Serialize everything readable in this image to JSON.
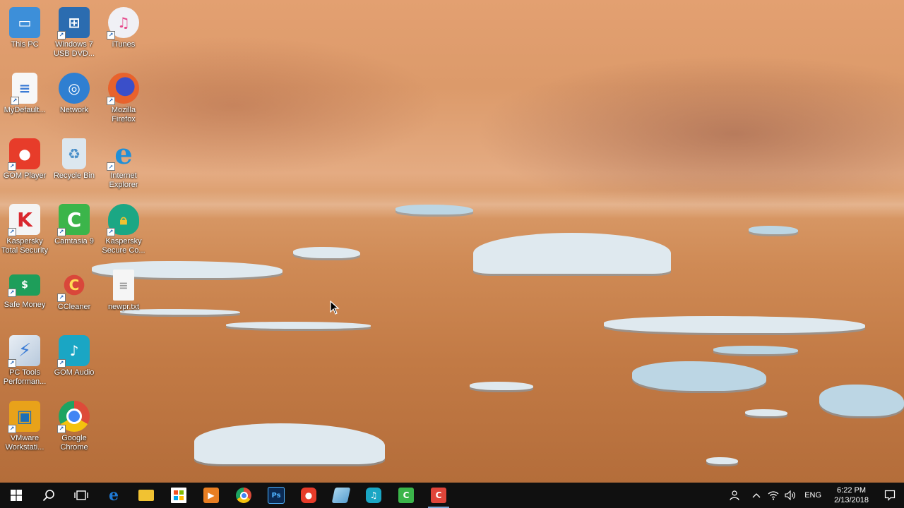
{
  "desktop": {
    "icons": [
      {
        "label": "This PC",
        "icon": "this-pc-icon",
        "color": "#3d8fd9"
      },
      {
        "label": "Windows 7 USB DVD...",
        "icon": "windows-usb-tool-icon",
        "color": "#2b6cb0"
      },
      {
        "label": "iTunes",
        "icon": "itunes-icon",
        "color": "#f0f0f5"
      },
      {
        "label": "MyDefault...",
        "icon": "document-icon",
        "color": "#f7f7f7"
      },
      {
        "label": "Network",
        "icon": "network-icon",
        "color": "#2f7fd1"
      },
      {
        "label": "Mozilla Firefox",
        "icon": "firefox-icon",
        "color": "#e8622c"
      },
      {
        "label": "GOM Player",
        "icon": "gom-player-icon",
        "color": "#e73c2a"
      },
      {
        "label": "Recycle Bin",
        "icon": "recycle-bin-icon",
        "color": "#dce7ef"
      },
      {
        "label": "Internet Explorer",
        "icon": "internet-explorer-icon",
        "color": "#1f8fd8"
      },
      {
        "label": "Kaspersky Total Security",
        "icon": "kaspersky-icon",
        "color": "#f4f4f4"
      },
      {
        "label": "Camtasia 9",
        "icon": "camtasia-icon",
        "color": "#3bb54a"
      },
      {
        "label": "Kaspersky Secure Co...",
        "icon": "kaspersky-vpn-icon",
        "color": "#1ba784"
      },
      {
        "label": "Safe Money",
        "icon": "safe-money-icon",
        "color": "#1e9e5a"
      },
      {
        "label": "CCleaner",
        "icon": "ccleaner-icon",
        "color": "#d9473a"
      },
      {
        "label": "newpr.txt",
        "icon": "text-file-icon",
        "color": "#f5f5f5"
      },
      {
        "label": "PC Tools Performan...",
        "icon": "pc-tools-icon",
        "color": "#3a7bd5"
      },
      {
        "label": "GOM Audio",
        "icon": "gom-audio-icon",
        "color": "#1aa6c4"
      },
      {
        "label": "VMware Workstati...",
        "icon": "vmware-icon",
        "color": "#e8a21a"
      },
      {
        "label": "Google Chrome",
        "icon": "chrome-icon",
        "color": "#dd4b39"
      }
    ]
  },
  "taskbar": {
    "start": {
      "icon": "windows-start-icon"
    },
    "search": {
      "icon": "search-icon"
    },
    "task_view": {
      "icon": "task-view-icon"
    },
    "pinned": [
      {
        "name": "Microsoft Edge",
        "icon": "edge-icon",
        "glyph": "e",
        "color": "#1f7ad6",
        "running": false
      },
      {
        "name": "File Explorer",
        "icon": "file-explorer-icon",
        "glyph": "",
        "color": "#f1c232",
        "running": false
      },
      {
        "name": "Microsoft Store",
        "icon": "store-icon",
        "glyph": "",
        "color": "#3a8fd9",
        "running": false
      },
      {
        "name": "Media Player",
        "icon": "media-player-icon",
        "glyph": "▶",
        "color": "#e87e22",
        "running": false
      },
      {
        "name": "Google Chrome",
        "icon": "chrome-icon",
        "glyph": "",
        "color": "#dd4b39",
        "running": false
      },
      {
        "name": "Photoshop",
        "icon": "photoshop-icon",
        "glyph": "Ps",
        "color": "#0b2a53",
        "running": false
      },
      {
        "name": "GOM Player",
        "icon": "gom-player-icon",
        "glyph": "",
        "color": "#e73c2a",
        "running": false
      },
      {
        "name": "Notepad",
        "icon": "notepad-icon",
        "glyph": "",
        "color": "#6fb3d9",
        "running": false
      },
      {
        "name": "GOM Audio",
        "icon": "gom-audio-icon",
        "glyph": "♫",
        "color": "#1aa6c4",
        "running": false
      },
      {
        "name": "Camtasia",
        "icon": "camtasia-icon",
        "glyph": "C",
        "color": "#3bb54a",
        "running": false
      },
      {
        "name": "Camtasia Recorder",
        "icon": "camtasia-recorder-icon",
        "glyph": "C",
        "color": "#e0453a",
        "running": true
      }
    ],
    "tray": {
      "people_icon": "people-icon",
      "overflow_icon": "chevron-up-icon",
      "network_icon": "wifi-icon",
      "volume_icon": "volume-icon",
      "language": "ENG",
      "time": "6:22 PM",
      "date": "2/13/2018",
      "notification_icon": "action-center-icon"
    }
  }
}
